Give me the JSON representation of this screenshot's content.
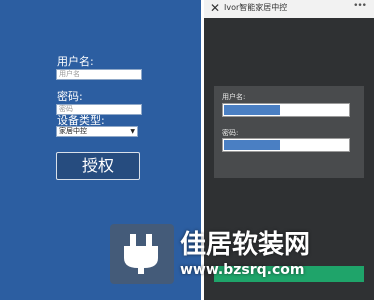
{
  "left_form": {
    "username_label": "用户名:",
    "username_placeholder": "用户名",
    "password_label": "密码:",
    "password_placeholder": "密码",
    "device_type_label": "设备类型:",
    "device_type_selected": "家居中控",
    "authorize_button": "授权"
  },
  "phone": {
    "title": "Ivor智能家居中控",
    "close_glyph": "✕",
    "more_glyph": "•••",
    "username_label": "用户名:",
    "password_label": "密码:",
    "username_fill_fraction": 0.45,
    "password_fill_fraction": 0.45
  },
  "watermark": {
    "brand": "佳居软装网",
    "url": "www.bzsrq.com"
  },
  "colors": {
    "left_bg": "#2c5ea1",
    "phone_bg": "#2f3133",
    "card_bg": "#494b4d",
    "field_fill": "#4a7fc3",
    "green_bar": "#1fa46a"
  }
}
